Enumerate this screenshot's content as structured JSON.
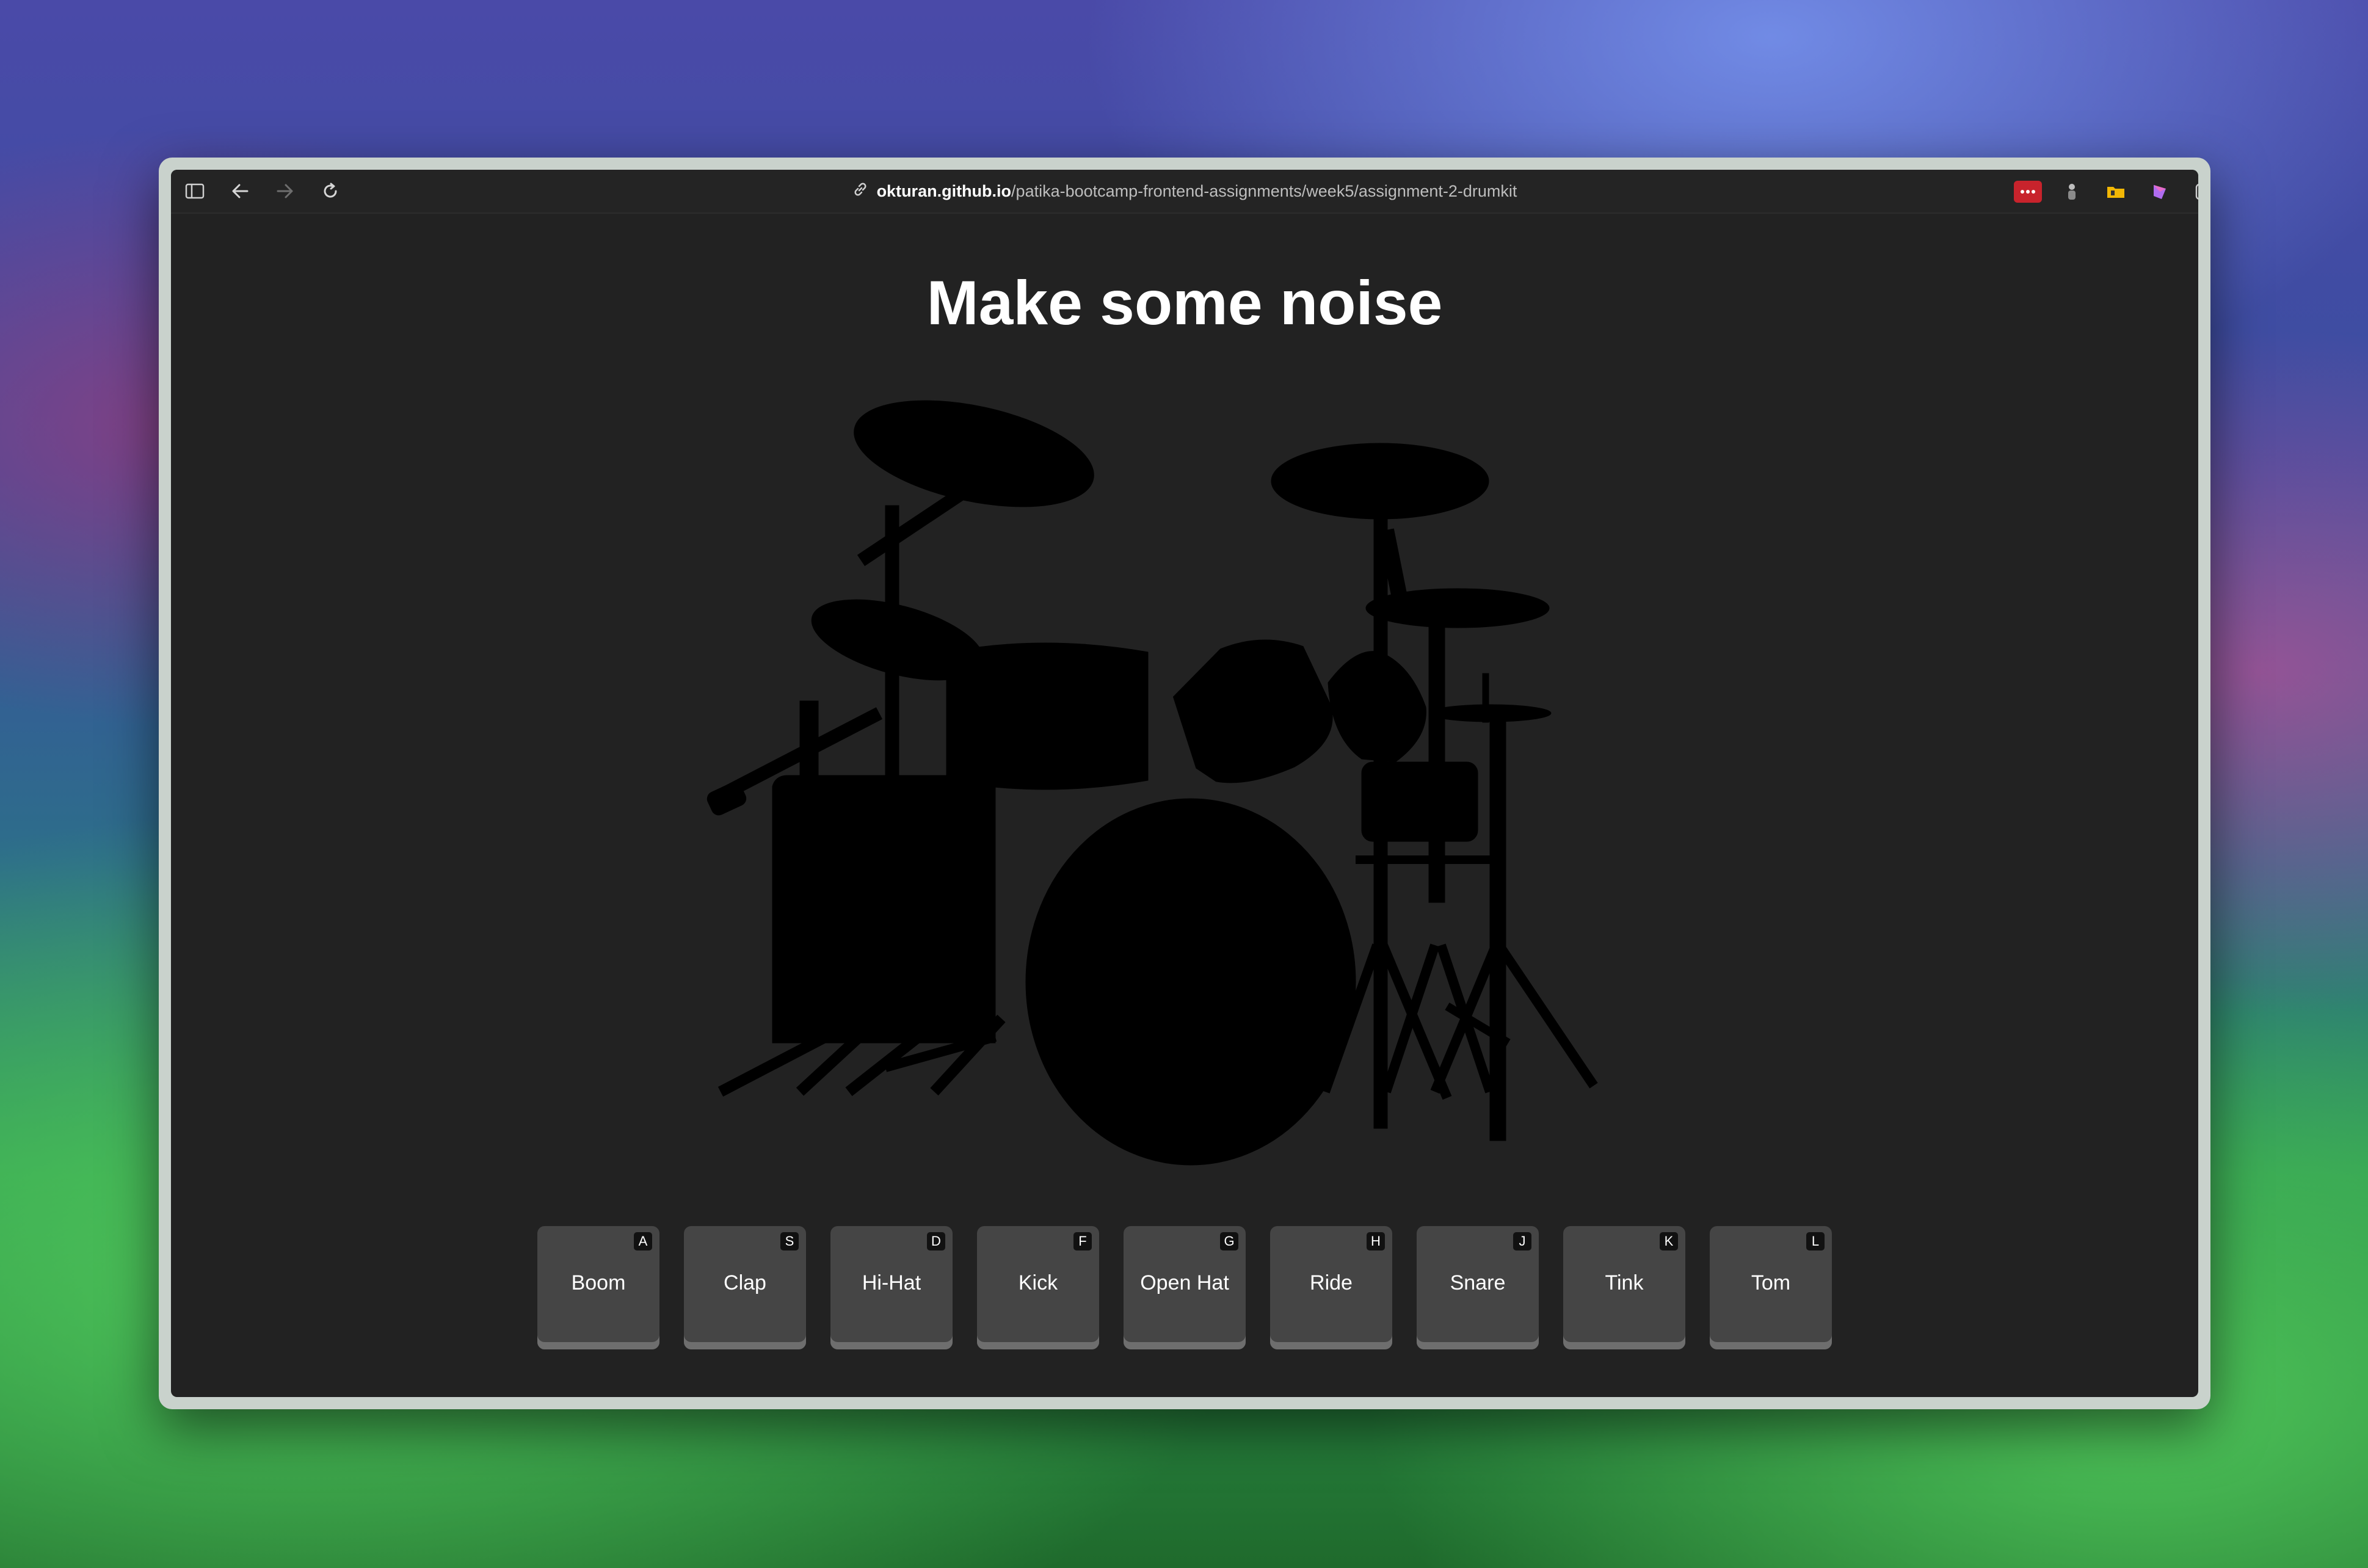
{
  "browser": {
    "url_host": "okturan.github.io",
    "url_path": "/patika-bootcamp-frontend-assignments/week5/assignment-2-drumkit",
    "toolbar_icons": [
      "sidebar-icon",
      "back-icon",
      "forward-icon",
      "reload-icon",
      "link-icon"
    ],
    "extension_icons": [
      "extension-red-icon",
      "extension-figure-icon",
      "extension-folder-icon",
      "extension-color-icon",
      "extension-reader-icon",
      "split-view-icon"
    ]
  },
  "page": {
    "title": "Make some noise"
  },
  "keys": [
    {
      "letter": "A",
      "label": "Boom"
    },
    {
      "letter": "S",
      "label": "Clap"
    },
    {
      "letter": "D",
      "label": "Hi-Hat"
    },
    {
      "letter": "F",
      "label": "Kick"
    },
    {
      "letter": "G",
      "label": "Open Hat"
    },
    {
      "letter": "H",
      "label": "Ride"
    },
    {
      "letter": "J",
      "label": "Snare"
    },
    {
      "letter": "K",
      "label": "Tink"
    },
    {
      "letter": "L",
      "label": "Tom"
    }
  ]
}
